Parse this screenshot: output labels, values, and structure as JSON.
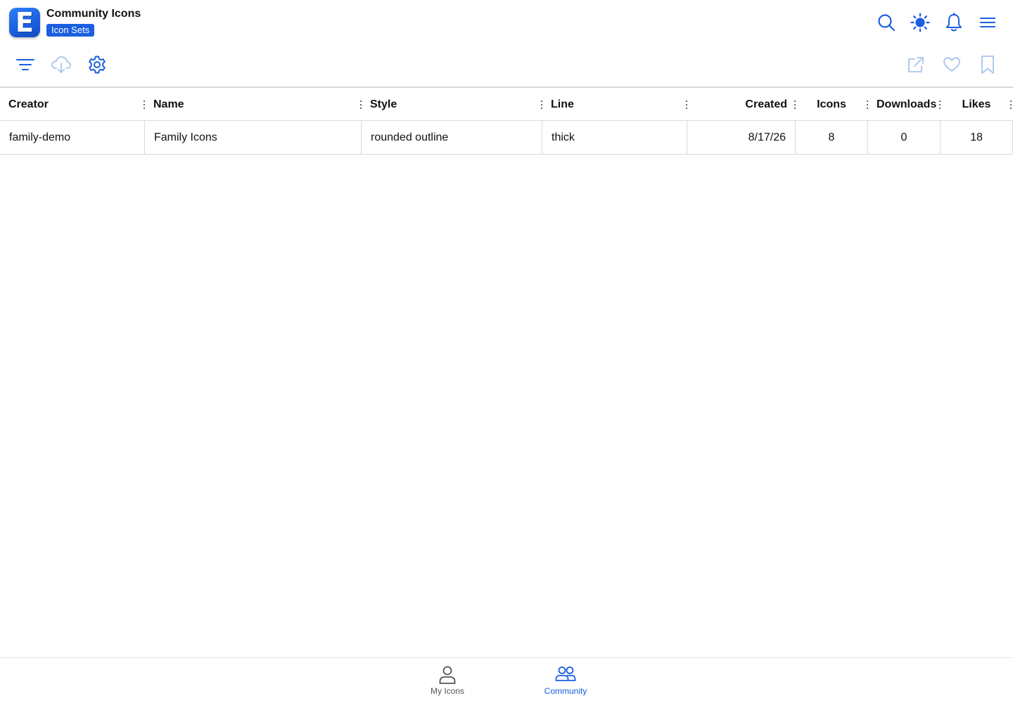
{
  "app": {
    "logo_letter": "E",
    "title": "Community Icons",
    "badge": "Icon Sets"
  },
  "header_actions": [
    {
      "name": "search-icon",
      "label": "Search"
    },
    {
      "name": "theme-sun-icon",
      "label": "Theme"
    },
    {
      "name": "bell-icon",
      "label": "Notifications"
    },
    {
      "name": "hamburger-menu-icon",
      "label": "Menu"
    }
  ],
  "toolbar": {
    "left": [
      "filter-icon",
      "cloud-download-icon",
      "gear-icon"
    ],
    "right": [
      "open-external-icon",
      "heart-icon",
      "bookmark-icon"
    ]
  },
  "table": {
    "columns": [
      "Creator",
      "Name",
      "Style",
      "Line",
      "Created",
      "Icons",
      "Downloads",
      "Likes"
    ],
    "rows": [
      {
        "creator": "family-demo",
        "name": "Family Icons",
        "style": "rounded outline",
        "line": "thick",
        "created": "8/17/26",
        "icons": "8",
        "downloads": "0",
        "likes": "18"
      }
    ]
  },
  "bottom_nav": {
    "items": [
      {
        "label": "My Icons",
        "icon": "person-icon",
        "active": false
      },
      {
        "label": "Community",
        "icon": "people-icon",
        "active": true
      }
    ]
  },
  "colors": {
    "accent": "#1a5fe0",
    "muted_icon": "#a9c3ef",
    "inactive_nav": "#555555",
    "border": "#d9d9d9"
  }
}
